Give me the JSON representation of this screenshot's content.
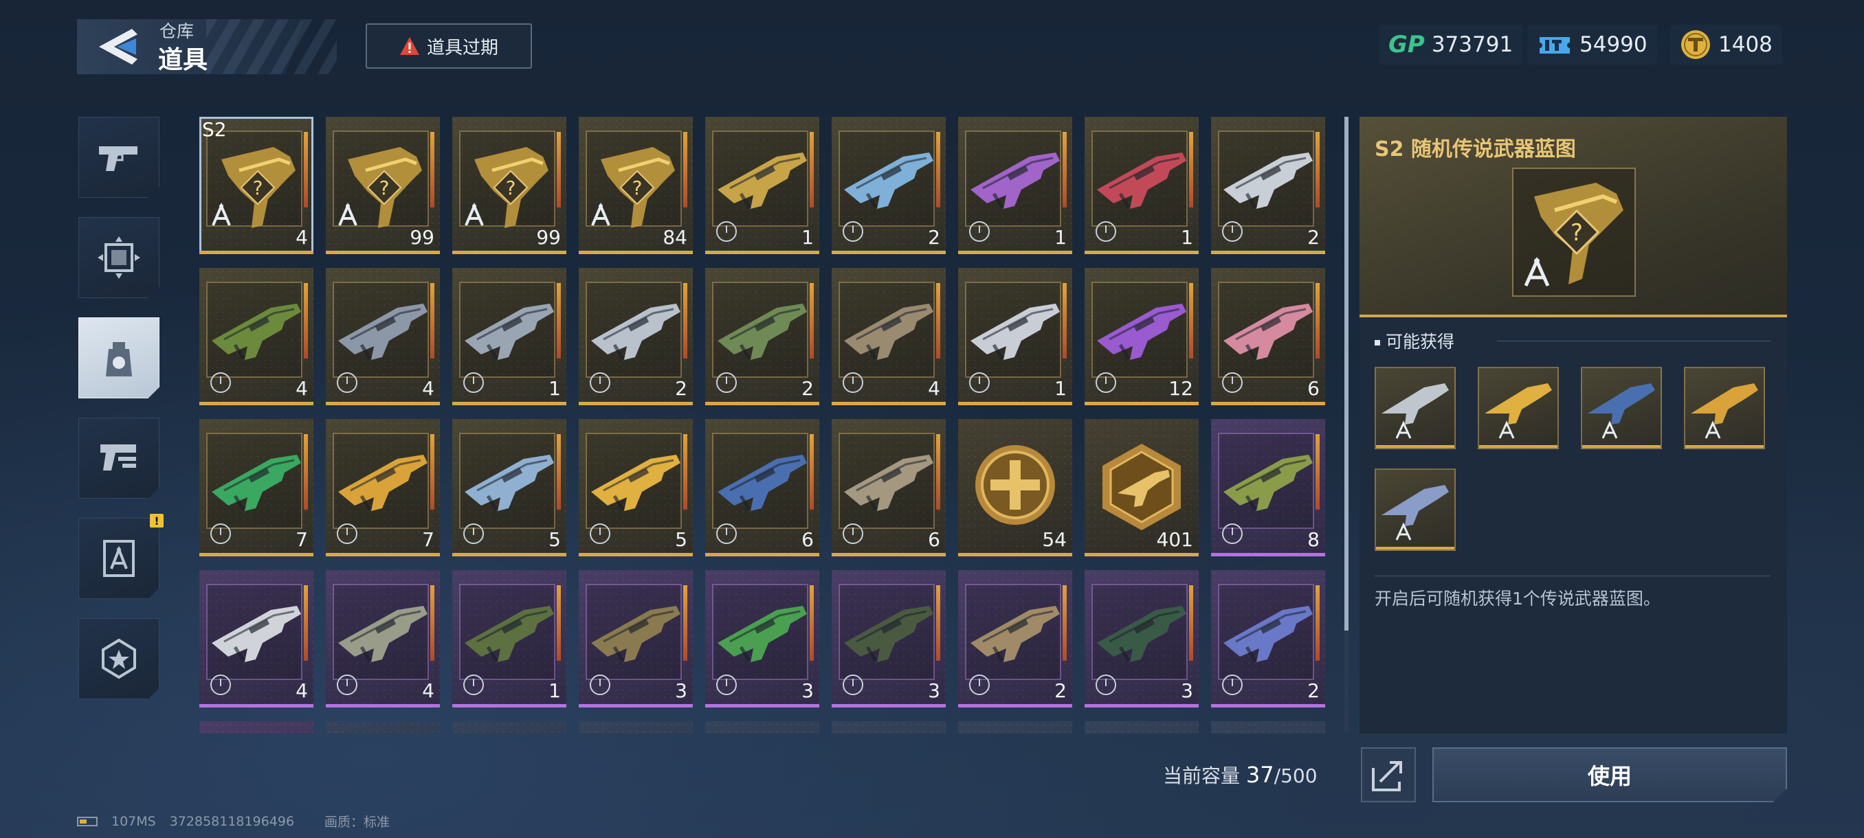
{
  "header": {
    "breadcrumb_parent": "仓库",
    "page_title": "道具",
    "expire_button": "道具过期"
  },
  "currencies": [
    {
      "name": "gp",
      "label": "GP",
      "value": "373791",
      "color": "#3ec38a"
    },
    {
      "name": "ticket",
      "value": "54990",
      "color": "#4aa8e8"
    },
    {
      "name": "coin",
      "value": "1408",
      "color": "#e0b040"
    }
  ],
  "tabs": [
    {
      "icon": "pistol-icon",
      "active": false
    },
    {
      "icon": "frame-icon",
      "active": false
    },
    {
      "icon": "item-bag-icon",
      "active": true
    },
    {
      "icon": "weapon-parts-icon",
      "active": false
    },
    {
      "icon": "blueprint-icon",
      "active": false,
      "badge": "!"
    },
    {
      "icon": "star-badge-icon",
      "active": false
    }
  ],
  "grid": {
    "items": [
      {
        "type": "blueprint",
        "rarity": "gold",
        "qty": "4",
        "tag": "S2",
        "selected": true
      },
      {
        "type": "blueprint",
        "rarity": "gold",
        "qty": "99"
      },
      {
        "type": "blueprint",
        "rarity": "gold",
        "qty": "99"
      },
      {
        "type": "blueprint",
        "rarity": "gold",
        "qty": "84"
      },
      {
        "type": "weapon",
        "rarity": "gold",
        "qty": "1",
        "timed": true,
        "color": "#c7a448"
      },
      {
        "type": "weapon",
        "rarity": "gold",
        "qty": "2",
        "timed": true,
        "color": "#7fb0d8"
      },
      {
        "type": "weapon",
        "rarity": "gold",
        "qty": "1",
        "timed": true,
        "color": "#a164c8"
      },
      {
        "type": "weapon",
        "rarity": "gold",
        "qty": "1",
        "timed": true,
        "color": "#c24a58"
      },
      {
        "type": "weapon",
        "rarity": "gold",
        "qty": "2",
        "timed": true,
        "color": "#c9cfd6"
      },
      {
        "type": "weapon",
        "rarity": "gold",
        "qty": "4",
        "timed": true,
        "color": "#6c8a3c"
      },
      {
        "type": "weapon",
        "rarity": "gold",
        "qty": "4",
        "timed": true,
        "color": "#8c97a8"
      },
      {
        "type": "weapon",
        "rarity": "gold",
        "qty": "1",
        "timed": true,
        "color": "#9aa5b4"
      },
      {
        "type": "weapon",
        "rarity": "gold",
        "qty": "2",
        "timed": true,
        "color": "#b8c1cc"
      },
      {
        "type": "weapon",
        "rarity": "gold",
        "qty": "2",
        "timed": true,
        "color": "#6f8a54"
      },
      {
        "type": "weapon",
        "rarity": "gold",
        "qty": "4",
        "timed": true,
        "color": "#9a8a70"
      },
      {
        "type": "weapon",
        "rarity": "gold",
        "qty": "1",
        "timed": true,
        "color": "#c9ced6"
      },
      {
        "type": "weapon",
        "rarity": "gold",
        "qty": "12",
        "timed": true,
        "color": "#9a5ad0"
      },
      {
        "type": "weapon",
        "rarity": "gold",
        "qty": "6",
        "timed": true,
        "color": "#d58aa0"
      },
      {
        "type": "weapon",
        "rarity": "gold",
        "qty": "7",
        "timed": true,
        "color": "#3aa860"
      },
      {
        "type": "weapon",
        "rarity": "gold",
        "qty": "7",
        "timed": true,
        "color": "#d9a33a"
      },
      {
        "type": "weapon",
        "rarity": "gold",
        "qty": "5",
        "timed": true,
        "color": "#8fb0d0"
      },
      {
        "type": "weapon",
        "rarity": "gold",
        "qty": "5",
        "timed": true,
        "color": "#e0b040"
      },
      {
        "type": "weapon",
        "rarity": "gold",
        "qty": "6",
        "timed": true,
        "color": "#4a6fb0"
      },
      {
        "type": "weapon",
        "rarity": "gold",
        "qty": "6",
        "timed": true,
        "color": "#a59880"
      },
      {
        "type": "medal",
        "rarity": "medal",
        "qty": "54"
      },
      {
        "type": "badge",
        "rarity": "medal",
        "qty": "401"
      },
      {
        "type": "weapon",
        "rarity": "purple",
        "qty": "8",
        "timed": true,
        "color": "#8a9c4a"
      },
      {
        "type": "weapon",
        "rarity": "purple",
        "qty": "4",
        "timed": true,
        "color": "#d0d4da"
      },
      {
        "type": "weapon",
        "rarity": "purple",
        "qty": "4",
        "timed": true,
        "color": "#9a9c8a"
      },
      {
        "type": "weapon",
        "rarity": "purple",
        "qty": "1",
        "timed": true,
        "color": "#5c7040"
      },
      {
        "type": "weapon",
        "rarity": "purple",
        "qty": "3",
        "timed": true,
        "color": "#8a7a50"
      },
      {
        "type": "weapon",
        "rarity": "purple",
        "qty": "3",
        "timed": true,
        "color": "#4aa050"
      },
      {
        "type": "weapon",
        "rarity": "purple",
        "qty": "3",
        "timed": true,
        "color": "#4a5a40"
      },
      {
        "type": "weapon",
        "rarity": "purple",
        "qty": "2",
        "timed": true,
        "color": "#a08a68"
      },
      {
        "type": "weapon",
        "rarity": "purple",
        "qty": "3",
        "timed": true,
        "color": "#3a5a48"
      },
      {
        "type": "weapon",
        "rarity": "purple",
        "qty": "2",
        "timed": true,
        "color": "#6a78c8"
      },
      {
        "type": "empty",
        "rarity": "purple"
      },
      {
        "type": "empty",
        "rarity": "normal"
      },
      {
        "type": "empty",
        "rarity": "normal"
      },
      {
        "type": "empty",
        "rarity": "normal"
      },
      {
        "type": "empty",
        "rarity": "normal"
      },
      {
        "type": "empty",
        "rarity": "normal"
      },
      {
        "type": "empty",
        "rarity": "normal"
      },
      {
        "type": "empty",
        "rarity": "normal"
      },
      {
        "type": "empty",
        "rarity": "normal"
      }
    ]
  },
  "detail": {
    "title": "S2 随机传说武器蓝图",
    "possible_title": "可能获得",
    "rewards": [
      {
        "color": "#c0c6ce"
      },
      {
        "color": "#e0b040"
      },
      {
        "color": "#4a6fb0"
      },
      {
        "color": "#d9a33a"
      },
      {
        "color": "#8a9cc8"
      }
    ],
    "description": "开启后可随机获得1个传说武器蓝图。"
  },
  "footer": {
    "capacity_label": "当前容量",
    "capacity_current": "37",
    "capacity_max": "/500",
    "use_button": "使用"
  },
  "status_bar": {
    "ping": "107MS",
    "player_id": "372858118196496",
    "quality": "画质：标准"
  }
}
